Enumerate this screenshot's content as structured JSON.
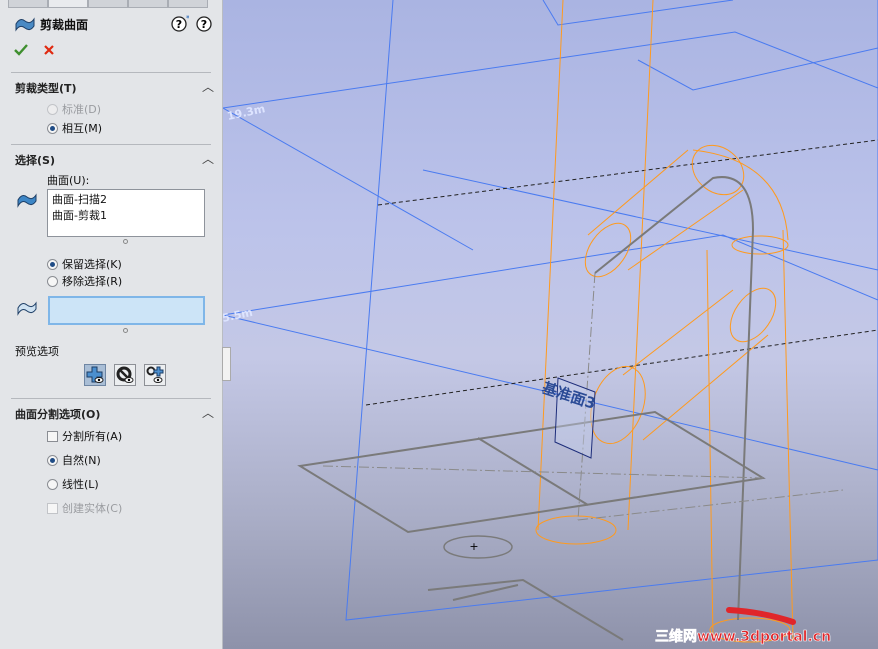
{
  "panel": {
    "title": "剪裁曲面",
    "ok_icon": "checkmark-icon",
    "cancel_icon": "close-icon",
    "trim_type": {
      "title": "剪裁类型(T)",
      "options": [
        {
          "label": "标准(D)",
          "selected": false,
          "disabled": true
        },
        {
          "label": "相互(M)",
          "selected": true,
          "disabled": false
        }
      ]
    },
    "selection": {
      "title": "选择(S)",
      "surfaces_label": "曲面(U):",
      "surfaces": [
        "曲面-扫描2",
        "曲面-剪裁1"
      ],
      "keep_options": [
        {
          "label": "保留选择(K)",
          "selected": true
        },
        {
          "label": "移除选择(R)",
          "selected": false
        }
      ],
      "preview_label": "预览选项"
    },
    "split_options": {
      "title": "曲面分割选项(O)",
      "split_all": {
        "label": "分割所有(A)",
        "checked": false
      },
      "options": [
        {
          "label": "自然(N)",
          "selected": true
        },
        {
          "label": "线性(L)",
          "selected": false
        }
      ],
      "create_solid": {
        "label": "创建实体(C)",
        "checked": false,
        "disabled": true
      }
    }
  },
  "viewport": {
    "plane_label": "基准面3",
    "dim_label_1": "19.3m",
    "dim_label_2": "5.5m",
    "watermark": "三维网www.3dportal.cn",
    "colors": {
      "plane": "#4a7bf0",
      "edge": "#ff9a1e",
      "sketch": "#7a7a7a",
      "watermark": "#e0262a"
    }
  }
}
